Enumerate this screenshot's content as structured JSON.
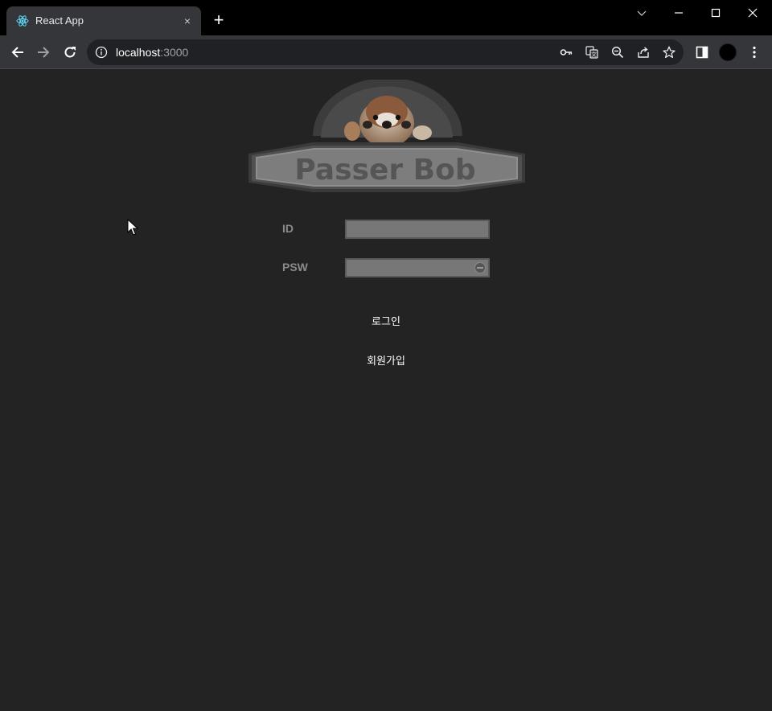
{
  "browser": {
    "tab_title": "React App",
    "tab_close": "×",
    "new_tab": "+",
    "url_host": "localhost",
    "url_port": ":3000"
  },
  "logo": {
    "text": "Passer Bob"
  },
  "login_form": {
    "id_label": "ID",
    "id_value": "",
    "psw_label": "PSW",
    "psw_value": "",
    "login_label": "로그인",
    "signup_label": "회원가입"
  },
  "colors": {
    "page_background": "#232323",
    "field_background": "#777777",
    "label_color": "#8a8a8a",
    "logo_text": "#555555"
  },
  "icons": [
    "react-icon",
    "back-icon",
    "forward-icon",
    "reload-icon",
    "info-icon",
    "key-icon",
    "translate-icon",
    "zoom-icon",
    "share-icon",
    "star-icon",
    "side-panel-icon",
    "menu-icon",
    "minimize-icon",
    "maximize-icon",
    "close-icon",
    "tab-search-icon",
    "password-toggle-icon"
  ]
}
